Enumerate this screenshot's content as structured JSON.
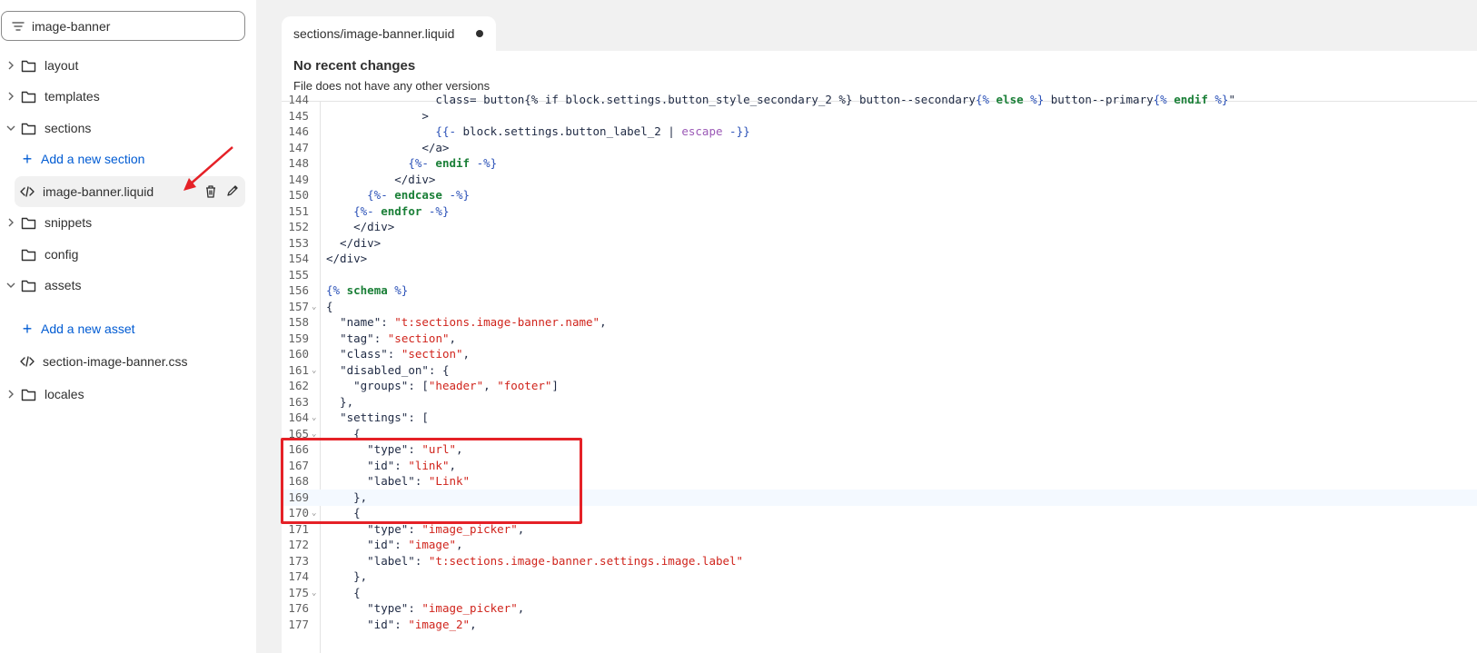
{
  "sidebar": {
    "filter": {
      "value": "image-banner",
      "placeholder": ""
    },
    "items": {
      "layout": "layout",
      "templates": "templates",
      "sections": "sections",
      "add_section": "Add a new section",
      "active_file": "image-banner.liquid",
      "snippets": "snippets",
      "config": "config",
      "assets": "assets",
      "add_asset": "Add a new asset",
      "asset_file": "section-image-banner.css",
      "locales": "locales"
    }
  },
  "editor": {
    "tab": {
      "dir": "sections/",
      "name": "image-banner.liquid"
    },
    "notice": {
      "title": "No recent changes",
      "subtitle": "File does not have any other versions"
    },
    "lines": [
      {
        "n": "144",
        "html": "                class= button{% if block.settings.button_style_secondary_2 %} button--secondary{% else %} button--primary{% endif %}\""
      },
      {
        "n": "145",
        "text": "              >"
      },
      {
        "n": "146",
        "text": "                {{- block.settings.button_label_2 | escape -}}"
      },
      {
        "n": "147",
        "text": "              </a>"
      },
      {
        "n": "148",
        "text": "            {%- endif -%}"
      },
      {
        "n": "149",
        "text": "          </div>"
      },
      {
        "n": "150",
        "text": "      {%- endcase -%}"
      },
      {
        "n": "151",
        "text": "    {%- endfor -%}"
      },
      {
        "n": "152",
        "text": "    </div>"
      },
      {
        "n": "153",
        "text": "  </div>"
      },
      {
        "n": "154",
        "text": "</div>"
      },
      {
        "n": "155",
        "text": ""
      },
      {
        "n": "156",
        "text": "{% schema %}"
      },
      {
        "n": "157",
        "text": "{"
      },
      {
        "n": "158",
        "text": "  \"name\": \"t:sections.image-banner.name\","
      },
      {
        "n": "159",
        "text": "  \"tag\": \"section\","
      },
      {
        "n": "160",
        "text": "  \"class\": \"section\","
      },
      {
        "n": "161",
        "text": "  \"disabled_on\": {"
      },
      {
        "n": "162",
        "text": "    \"groups\": [\"header\", \"footer\"]"
      },
      {
        "n": "163",
        "text": "  },"
      },
      {
        "n": "164",
        "text": "  \"settings\": ["
      },
      {
        "n": "165",
        "text": "    {"
      },
      {
        "n": "166",
        "text": "      \"type\": \"url\","
      },
      {
        "n": "167",
        "text": "      \"id\": \"link\","
      },
      {
        "n": "168",
        "text": "      \"label\": \"Link\""
      },
      {
        "n": "169",
        "text": "    },"
      },
      {
        "n": "170",
        "text": "    {"
      },
      {
        "n": "171",
        "text": "      \"type\": \"image_picker\","
      },
      {
        "n": "172",
        "text": "      \"id\": \"image\","
      },
      {
        "n": "173",
        "text": "      \"label\": \"t:sections.image-banner.settings.image.label\""
      },
      {
        "n": "174",
        "text": "    },"
      },
      {
        "n": "175",
        "text": "    {"
      },
      {
        "n": "176",
        "text": "      \"type\": \"image_picker\","
      },
      {
        "n": "177",
        "text": "      \"id\": \"image_2\","
      }
    ],
    "foldable": [
      "157",
      "161",
      "164",
      "165",
      "170",
      "175"
    ],
    "highlight_line": "169"
  },
  "colors": {
    "accent": "#005bd3",
    "annotation": "#e52127",
    "keyword": "#1a7f37",
    "string": "#d0241c"
  }
}
